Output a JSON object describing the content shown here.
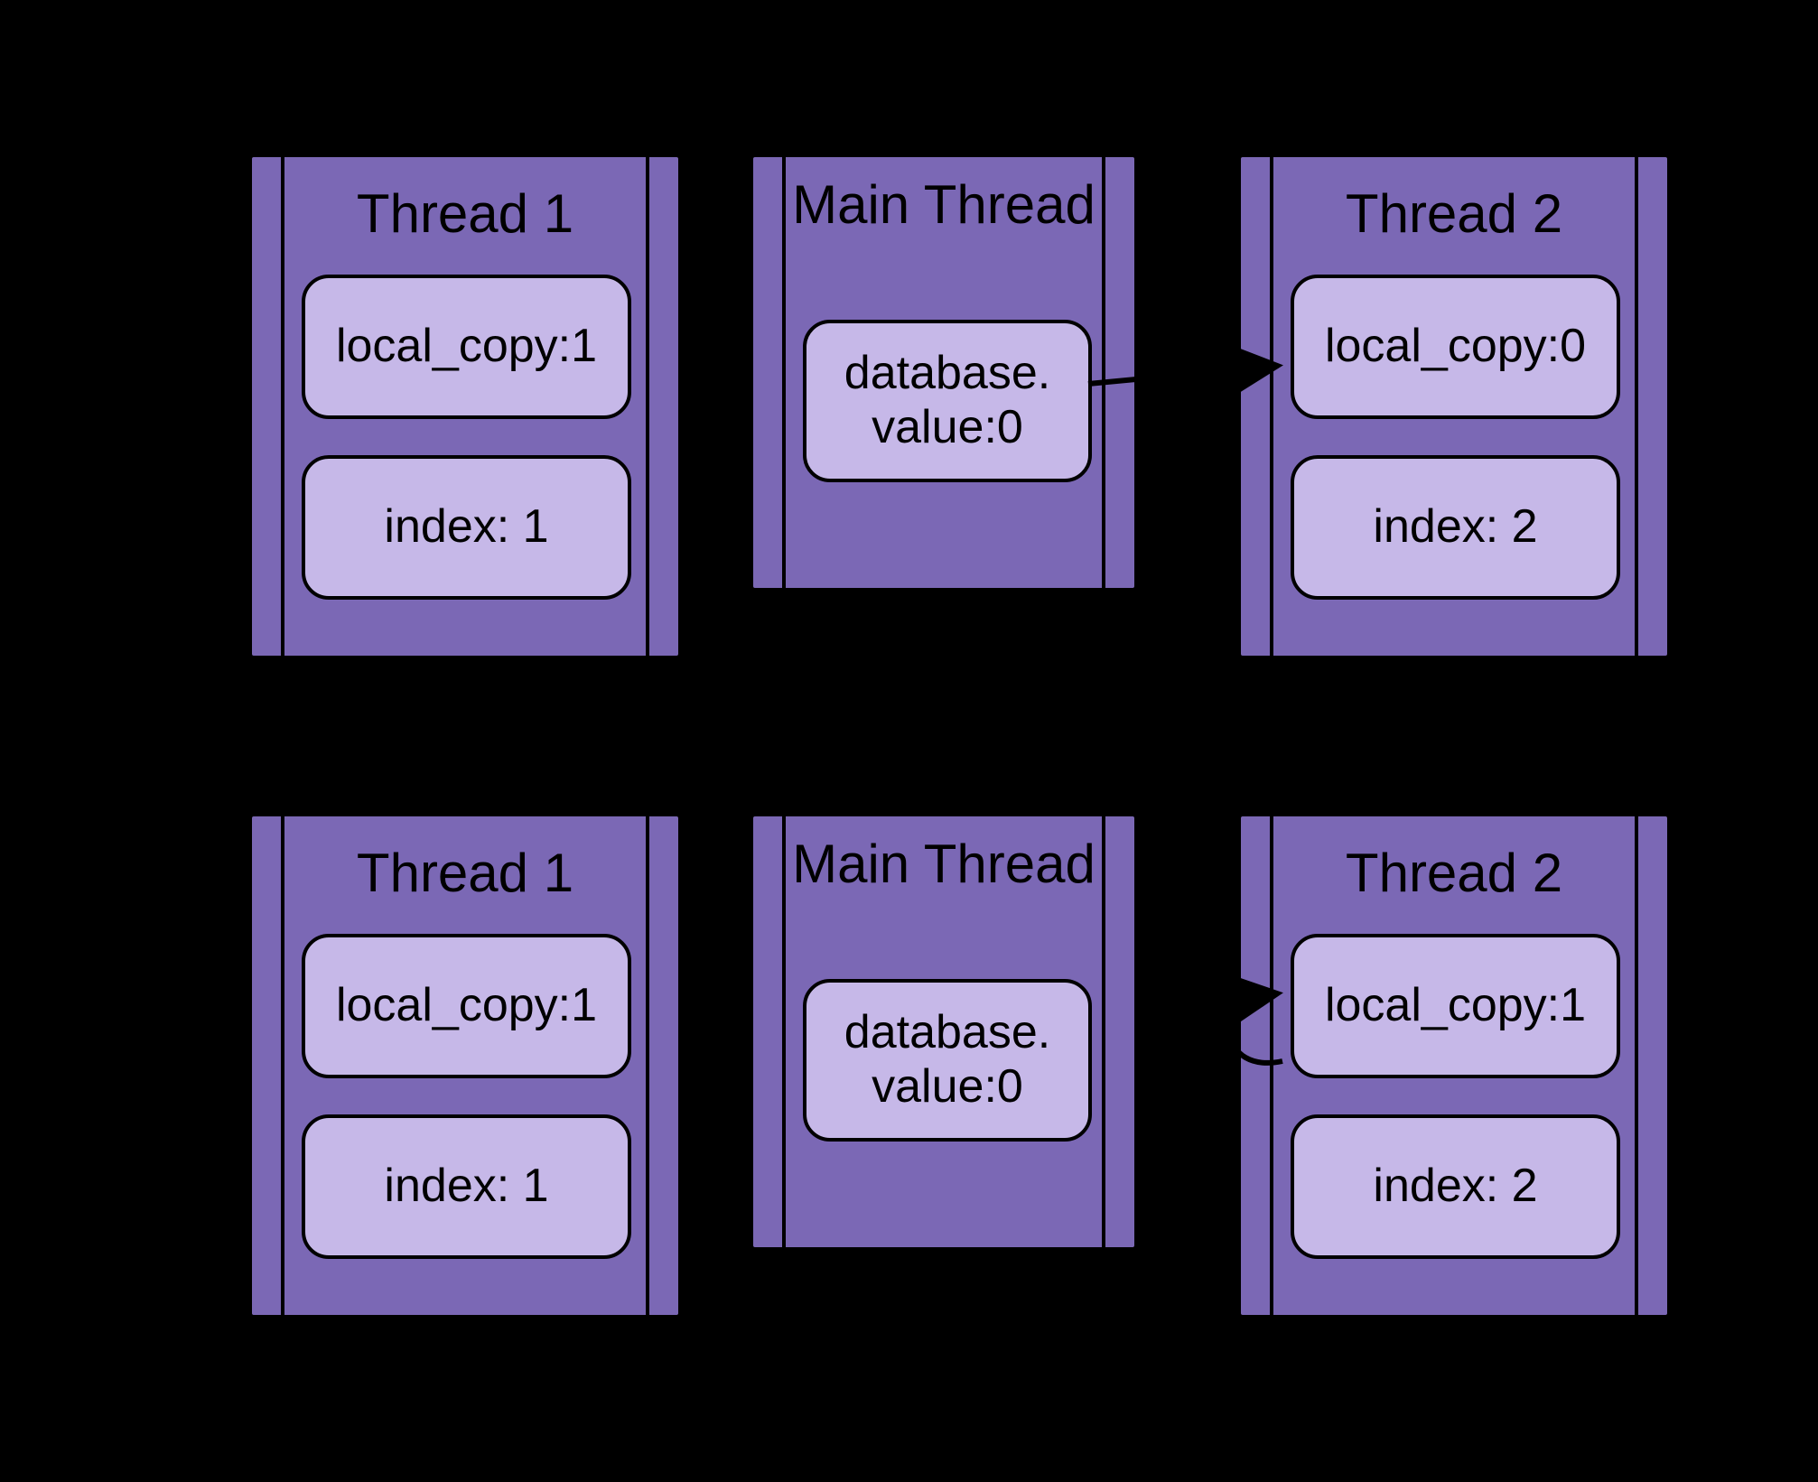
{
  "rows": [
    {
      "thread1": {
        "title": "Thread 1",
        "local_copy": "local_copy:1",
        "index": "index: 1"
      },
      "main": {
        "title": "Main Thread",
        "db": "database.\nvalue:0"
      },
      "thread2": {
        "title": "Thread 2",
        "local_copy": "local_copy:0",
        "index": "index: 2"
      },
      "arrow": {
        "from": "main",
        "to": "thread2",
        "type": "straight"
      }
    },
    {
      "thread1": {
        "title": "Thread 1",
        "local_copy": "local_copy:1",
        "index": "index: 1"
      },
      "main": {
        "title": "Main Thread",
        "db": "database.\nvalue:0"
      },
      "thread2": {
        "title": "Thread 2",
        "local_copy": "local_copy:1",
        "index": "index: 2"
      },
      "arrow": {
        "from": "thread2",
        "to": "thread2",
        "type": "loop"
      }
    }
  ]
}
